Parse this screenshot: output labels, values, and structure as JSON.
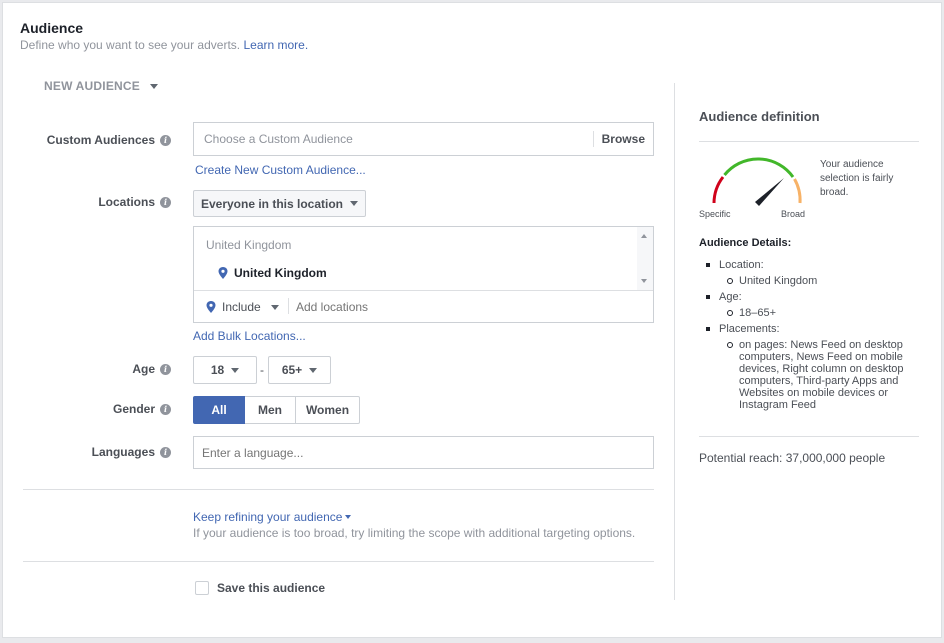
{
  "header": {
    "title": "Audience",
    "subtitle": "Define who you want to see your adverts.",
    "learn_more": "Learn more."
  },
  "new_audience": {
    "label": "NEW AUDIENCE"
  },
  "custom_audiences": {
    "label": "Custom Audiences",
    "placeholder": "Choose a Custom Audience",
    "browse": "Browse",
    "create_link": "Create New Custom Audience..."
  },
  "locations": {
    "label": "Locations",
    "dropdown": "Everyone in this location",
    "group_header": "United Kingdom",
    "selected": "United Kingdom",
    "include": "Include",
    "add_placeholder": "Add locations",
    "bulk_link": "Add Bulk Locations..."
  },
  "age": {
    "label": "Age",
    "min": "18",
    "separator": "-",
    "max": "65+"
  },
  "gender": {
    "label": "Gender",
    "options": [
      "All",
      "Men",
      "Women"
    ],
    "selected": "All"
  },
  "languages": {
    "label": "Languages",
    "placeholder": "Enter a language..."
  },
  "refine": {
    "link": "Keep refining your audience",
    "hint": "If your audience is too broad, try limiting the scope with additional targeting options."
  },
  "save": {
    "label": "Save this audience"
  },
  "definition": {
    "title": "Audience definition",
    "gauge_text": "Your audience selection is fairly broad.",
    "specific": "Specific",
    "broad": "Broad",
    "details_title": "Audience Details:",
    "location_label": "Location:",
    "location_value": "United Kingdom",
    "age_label": "Age:",
    "age_value": "18–65+",
    "placements_label": "Placements:",
    "placements_value": "on pages: News Feed on desktop computers, News Feed on mobile devices, Right column on desktop computers, Third-party Apps and Websites on mobile devices or Instagram Feed",
    "potential_reach": "Potential reach: 37,000,000 people"
  },
  "colors": {
    "accent": "#4267b2",
    "selected_button": "#4267b2",
    "gauge_red": "#d0021b",
    "gauge_green": "#42b72a",
    "gauge_orange": "#f7b267"
  }
}
